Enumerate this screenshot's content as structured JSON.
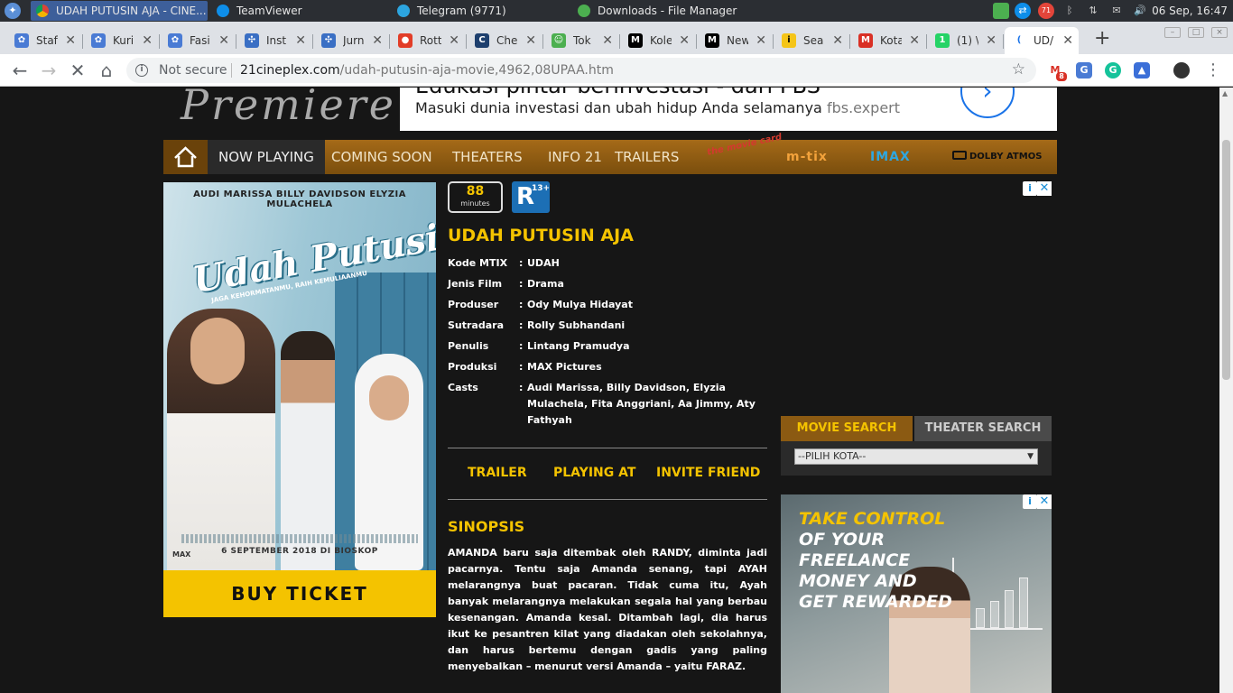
{
  "taskbar": {
    "windows": [
      {
        "title": "UDAH PUTUSIN AJA - CINE...",
        "active": true
      },
      {
        "title": "TeamViewer",
        "active": false
      },
      {
        "title": "Telegram (9771)",
        "active": false
      },
      {
        "title": "Downloads - File Manager",
        "active": false
      }
    ],
    "gmail_badge": "71",
    "clock": "06 Sep, 16:47"
  },
  "browser": {
    "tabs": [
      {
        "label": "Staf",
        "icon": "gear-icon",
        "color": "#4a7bd4"
      },
      {
        "label": "Kuri",
        "icon": "gear-icon",
        "color": "#4a7bd4"
      },
      {
        "label": "Fasi",
        "icon": "gear-icon",
        "color": "#4a7bd4"
      },
      {
        "label": "Inst",
        "icon": "molecule-icon",
        "color": "#3a6fc4"
      },
      {
        "label": "Jurn",
        "icon": "molecule-icon",
        "color": "#3a6fc4"
      },
      {
        "label": "Rott",
        "icon": "tomato-icon",
        "color": "#e23d28"
      },
      {
        "label": "Che",
        "icon": "c-icon",
        "color": "#1d3f6e"
      },
      {
        "label": "Tok",
        "icon": "robot-icon",
        "color": "#4caf50"
      },
      {
        "label": "Kole",
        "icon": "medium-icon",
        "color": "#000000"
      },
      {
        "label": "New",
        "icon": "medium-icon",
        "color": "#000000"
      },
      {
        "label": "Sea",
        "icon": "imdb-icon",
        "color": "#f5c518"
      },
      {
        "label": "Kota",
        "icon": "gmail-icon",
        "color": "#d93025"
      },
      {
        "label": "(1) \\",
        "icon": "whatsapp-icon",
        "color": "#25d366"
      },
      {
        "label": "UD/",
        "icon": "loading-icon",
        "color": "#1a73e8"
      }
    ],
    "omnibox": {
      "security": "Not secure",
      "host": "21cineplex.com",
      "path": "/udah-putusin-aja-movie,4962,08UPAA.htm"
    },
    "ext_gmail_badge": "8"
  },
  "page": {
    "logo_text": "Premiere",
    "top_ad": {
      "headline": "Edukasi pintar berinvestasi - dari FBS",
      "subtitle": "Masuki dunia investasi dan ubah hidup Anda selamanya",
      "domain": "fbs.expert"
    },
    "nav": {
      "items": [
        "NOW PLAYING",
        "COMING SOON",
        "THEATERS",
        "INFO 21",
        "TRAILERS"
      ],
      "brands": [
        "the movie card",
        "m-tix",
        "IMAX",
        "DOLBY ATMOS"
      ]
    },
    "poster": {
      "cast": "AUDI MARISSA     BILLY DAVIDSON     ELYZIA MULACHELA",
      "title": "Udah Putusin Aja!",
      "tagline": "JAGA KEHORMATANMU, RAIH KEMULIAANMU",
      "release": "6 SEPTEMBER 2018 DI BIOSKOP",
      "studio": "MAX"
    },
    "buy_ticket": "BUY TICKET",
    "duration": {
      "value": "88",
      "unit": "minutes"
    },
    "rating": {
      "letter": "R",
      "age": "13+"
    },
    "movie_title": "UDAH PUTUSIN AJA",
    "details": [
      {
        "key": "Kode MTIX",
        "value": "UDAH"
      },
      {
        "key": "Jenis Film",
        "value": "Drama"
      },
      {
        "key": "Produser",
        "value": "Ody Mulya Hidayat"
      },
      {
        "key": "Sutradara",
        "value": "Rolly Subhandani"
      },
      {
        "key": "Penulis",
        "value": "Lintang Pramudya"
      },
      {
        "key": "Produksi",
        "value": "MAX Pictures"
      },
      {
        "key": "Casts",
        "value": "Audi Marissa, Billy Davidson, Elyzia Mulachela, Fita Anggriani, Aa Jimmy, Aty Fathyah"
      }
    ],
    "actions": [
      "TRAILER",
      "PLAYING AT",
      "INVITE FRIEND"
    ],
    "sinopsis_heading": "SINOPSIS",
    "sinopsis": "AMANDA baru saja ditembak oleh RANDY, diminta jadi pacarnya. Tentu saja Amanda senang, tapi AYAH melarangnya buat pacaran. Tidak cuma itu, Ayah banyak melarangnya melakukan segala hal yang berbau kesenangan. Amanda kesal. Ditambah lagi, dia harus ikut ke pesantren kilat yang diadakan oleh sekolahnya, dan harus bertemu dengan gadis yang paling menyebalkan – menurut versi Amanda – yaitu FARAZ.",
    "search_tabs": [
      "MOVIE SEARCH",
      "THEATER SEARCH"
    ],
    "city_select": "--PILIH KOTA--",
    "side_ad": {
      "line1": "TAKE CONTROL",
      "line2": "OF YOUR FREELANCE",
      "line3": "MONEY AND",
      "line4": "GET REWARDED"
    }
  },
  "colors": {
    "accent": "#f4c300",
    "nav_brown": "#8b5a12",
    "rating_blue": "#1c6fb5"
  }
}
